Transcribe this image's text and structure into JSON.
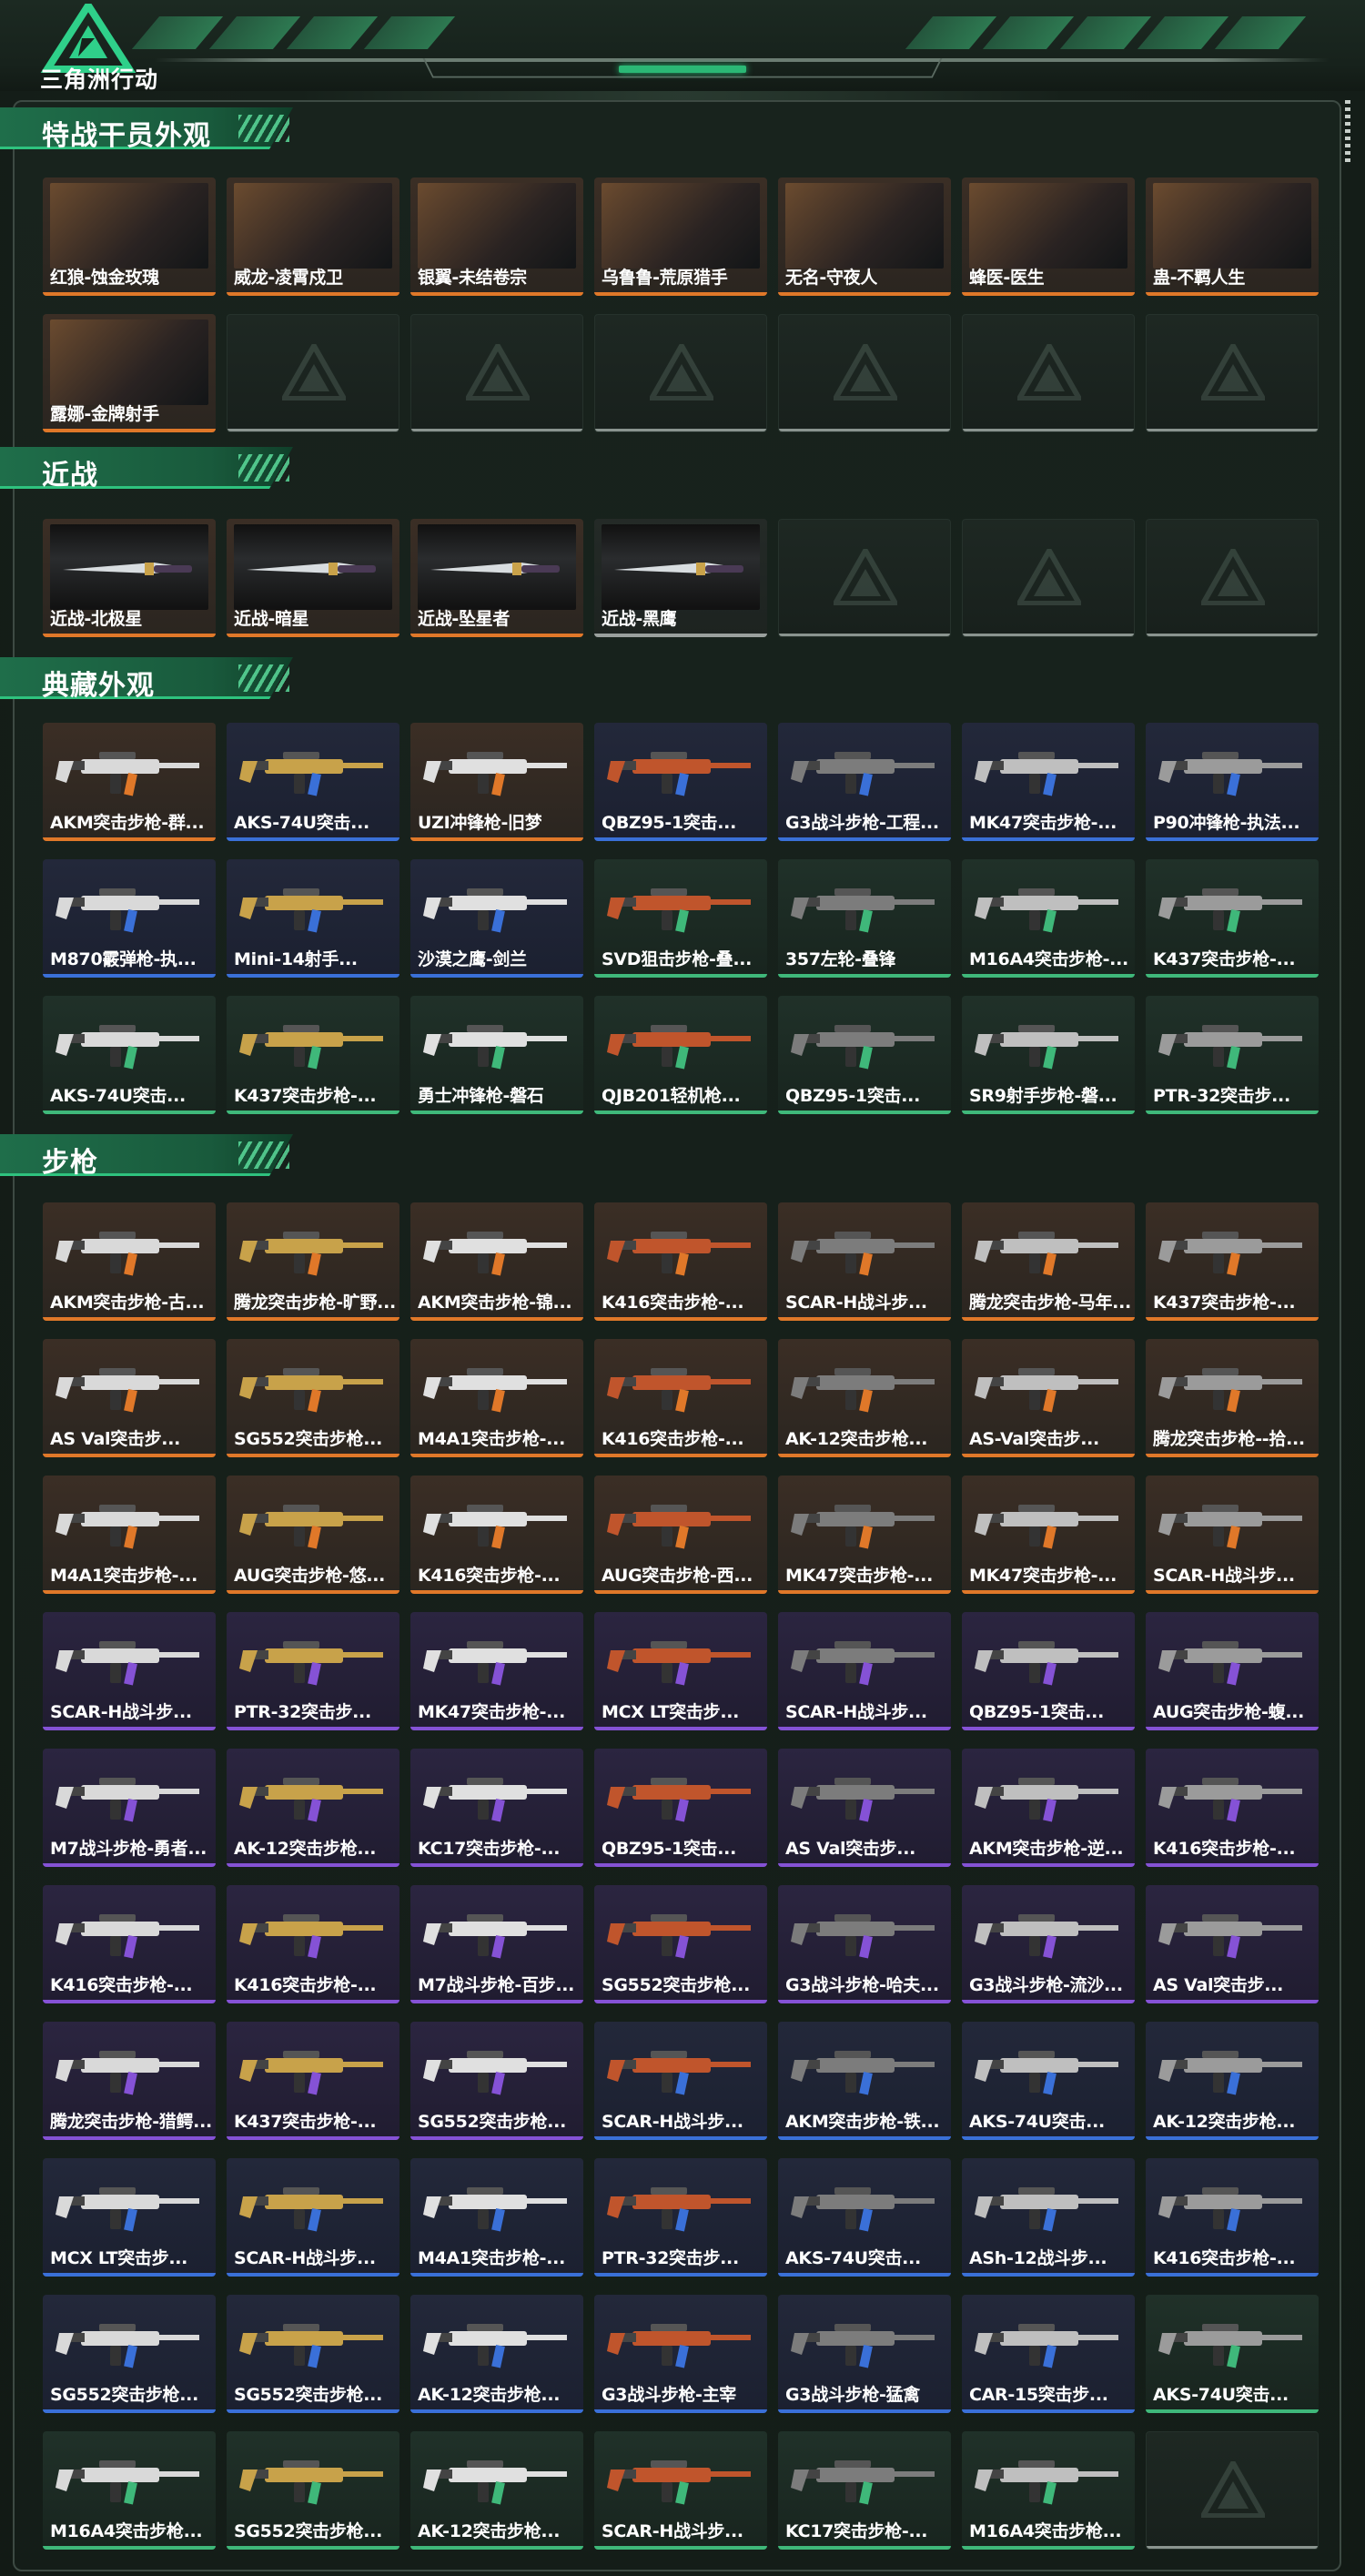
{
  "brand": {
    "logo_text": "三角洲行动"
  },
  "sections": [
    {
      "title": "特战干员外观",
      "items": [
        {
          "label": "红狼-蚀金玫瑰",
          "rarity": "orange",
          "kind": "photo"
        },
        {
          "label": "威龙-凌霄戍卫",
          "rarity": "orange",
          "kind": "photo"
        },
        {
          "label": "银翼-未结卷宗",
          "rarity": "orange",
          "kind": "photo"
        },
        {
          "label": "乌鲁鲁-荒原猎手",
          "rarity": "orange",
          "kind": "photo"
        },
        {
          "label": "无名-守夜人",
          "rarity": "orange",
          "kind": "photo"
        },
        {
          "label": "蜂医-医生",
          "rarity": "orange",
          "kind": "photo"
        },
        {
          "label": "蛊-不羁人生",
          "rarity": "orange",
          "kind": "photo"
        },
        {
          "label": "露娜-金牌射手",
          "rarity": "orange",
          "kind": "photo"
        },
        {
          "label": "",
          "rarity": "empty"
        },
        {
          "label": "",
          "rarity": "empty"
        },
        {
          "label": "",
          "rarity": "empty"
        },
        {
          "label": "",
          "rarity": "empty"
        },
        {
          "label": "",
          "rarity": "empty"
        },
        {
          "label": "",
          "rarity": "empty"
        }
      ]
    },
    {
      "title": "近战",
      "items": [
        {
          "label": "近战-北极星",
          "rarity": "orange",
          "kind": "knife"
        },
        {
          "label": "近战-暗星",
          "rarity": "orange",
          "kind": "knife"
        },
        {
          "label": "近战-坠星者",
          "rarity": "orange",
          "kind": "knife"
        },
        {
          "label": "近战-黑鹰",
          "rarity": "grey",
          "kind": "knife"
        },
        {
          "label": "",
          "rarity": "empty"
        },
        {
          "label": "",
          "rarity": "empty"
        },
        {
          "label": "",
          "rarity": "empty"
        }
      ]
    },
    {
      "title": "典藏外观",
      "items": [
        {
          "label": "AKM突击步枪-群...",
          "rarity": "orange"
        },
        {
          "label": "AKS-74U突击...",
          "rarity": "blue"
        },
        {
          "label": "UZI冲锋枪-旧梦",
          "rarity": "orange"
        },
        {
          "label": "QBZ95-1突击...",
          "rarity": "blue"
        },
        {
          "label": "G3战斗步枪-工程...",
          "rarity": "blue"
        },
        {
          "label": "MK47突击步枪-...",
          "rarity": "blue"
        },
        {
          "label": "P90冲锋枪-执法...",
          "rarity": "blue"
        },
        {
          "label": "M870霰弹枪-执...",
          "rarity": "blue"
        },
        {
          "label": "Mini-14射手...",
          "rarity": "blue"
        },
        {
          "label": "沙漠之鹰-剑兰",
          "rarity": "blue"
        },
        {
          "label": "SVD狙击步枪-叠...",
          "rarity": "green"
        },
        {
          "label": "357左轮-叠锋",
          "rarity": "green"
        },
        {
          "label": "M16A4突击步枪-...",
          "rarity": "green"
        },
        {
          "label": "K437突击步枪-...",
          "rarity": "green"
        },
        {
          "label": "AKS-74U突击...",
          "rarity": "green"
        },
        {
          "label": "K437突击步枪-...",
          "rarity": "green"
        },
        {
          "label": "勇士冲锋枪-磐石",
          "rarity": "green"
        },
        {
          "label": "QJB201轻机枪...",
          "rarity": "green"
        },
        {
          "label": "QBZ95-1突击...",
          "rarity": "green"
        },
        {
          "label": "SR9射手步枪-磐...",
          "rarity": "green"
        },
        {
          "label": "PTR-32突击步...",
          "rarity": "green"
        }
      ]
    },
    {
      "title": "步枪",
      "items": [
        {
          "label": "AKM突击步枪-古...",
          "rarity": "orange"
        },
        {
          "label": "腾龙突击步枪-旷野...",
          "rarity": "orange"
        },
        {
          "label": "AKM突击步枪-锦...",
          "rarity": "orange"
        },
        {
          "label": "K416突击步枪-...",
          "rarity": "orange"
        },
        {
          "label": "SCAR-H战斗步...",
          "rarity": "orange"
        },
        {
          "label": "腾龙突击步枪-马年...",
          "rarity": "orange"
        },
        {
          "label": "K437突击步枪-...",
          "rarity": "orange"
        },
        {
          "label": "AS Val突击步...",
          "rarity": "orange"
        },
        {
          "label": "SG552突击步枪...",
          "rarity": "orange"
        },
        {
          "label": "M4A1突击步枪-...",
          "rarity": "orange"
        },
        {
          "label": "K416突击步枪-...",
          "rarity": "orange"
        },
        {
          "label": "AK-12突击步枪...",
          "rarity": "orange"
        },
        {
          "label": "AS-Val突击步...",
          "rarity": "orange"
        },
        {
          "label": "腾龙突击步枪--拾...",
          "rarity": "orange"
        },
        {
          "label": "M4A1突击步枪-...",
          "rarity": "orange"
        },
        {
          "label": "AUG突击步枪-悠...",
          "rarity": "orange"
        },
        {
          "label": "K416突击步枪-...",
          "rarity": "orange"
        },
        {
          "label": "AUG突击步枪-西...",
          "rarity": "orange"
        },
        {
          "label": "MK47突击步枪-...",
          "rarity": "orange"
        },
        {
          "label": "MK47突击步枪-...",
          "rarity": "orange"
        },
        {
          "label": "SCAR-H战斗步...",
          "rarity": "orange"
        },
        {
          "label": "SCAR-H战斗步...",
          "rarity": "purple"
        },
        {
          "label": "PTR-32突击步...",
          "rarity": "purple"
        },
        {
          "label": "MK47突击步枪-...",
          "rarity": "purple"
        },
        {
          "label": "MCX LT突击步...",
          "rarity": "purple"
        },
        {
          "label": "SCAR-H战斗步...",
          "rarity": "purple"
        },
        {
          "label": "QBZ95-1突击...",
          "rarity": "purple"
        },
        {
          "label": "AUG突击步枪-蝮...",
          "rarity": "purple"
        },
        {
          "label": "M7战斗步枪-勇者...",
          "rarity": "purple"
        },
        {
          "label": "AK-12突击步枪...",
          "rarity": "purple"
        },
        {
          "label": "KC17突击步枪-...",
          "rarity": "purple"
        },
        {
          "label": "QBZ95-1突击...",
          "rarity": "purple"
        },
        {
          "label": "AS Val突击步...",
          "rarity": "purple"
        },
        {
          "label": "AKM突击步枪-逆...",
          "rarity": "purple"
        },
        {
          "label": "K416突击步枪-...",
          "rarity": "purple"
        },
        {
          "label": "K416突击步枪-...",
          "rarity": "purple"
        },
        {
          "label": "K416突击步枪-...",
          "rarity": "purple"
        },
        {
          "label": "M7战斗步枪-百步...",
          "rarity": "purple"
        },
        {
          "label": "SG552突击步枪...",
          "rarity": "purple"
        },
        {
          "label": "G3战斗步枪-哈夫...",
          "rarity": "purple"
        },
        {
          "label": "G3战斗步枪-流沙...",
          "rarity": "purple"
        },
        {
          "label": "AS Val突击步...",
          "rarity": "purple"
        },
        {
          "label": "腾龙突击步枪-猎鳄...",
          "rarity": "purple"
        },
        {
          "label": "K437突击步枪-...",
          "rarity": "purple"
        },
        {
          "label": "SG552突击步枪...",
          "rarity": "purple"
        },
        {
          "label": "SCAR-H战斗步...",
          "rarity": "blue"
        },
        {
          "label": "AKM突击步枪-铁...",
          "rarity": "blue"
        },
        {
          "label": "AKS-74U突击...",
          "rarity": "blue"
        },
        {
          "label": "AK-12突击步枪...",
          "rarity": "blue"
        },
        {
          "label": "MCX LT突击步...",
          "rarity": "blue"
        },
        {
          "label": "SCAR-H战斗步...",
          "rarity": "blue"
        },
        {
          "label": "M4A1突击步枪-...",
          "rarity": "blue"
        },
        {
          "label": "PTR-32突击步...",
          "rarity": "blue"
        },
        {
          "label": "AKS-74U突击...",
          "rarity": "blue"
        },
        {
          "label": "ASh-12战斗步...",
          "rarity": "blue"
        },
        {
          "label": "K416突击步枪-...",
          "rarity": "blue"
        },
        {
          "label": "SG552突击步枪...",
          "rarity": "blue"
        },
        {
          "label": "SG552突击步枪...",
          "rarity": "blue"
        },
        {
          "label": "AK-12突击步枪...",
          "rarity": "blue"
        },
        {
          "label": "G3战斗步枪-主宰",
          "rarity": "blue"
        },
        {
          "label": "G3战斗步枪-猛禽",
          "rarity": "blue"
        },
        {
          "label": "CAR-15突击步...",
          "rarity": "blue"
        },
        {
          "label": "AKS-74U突击...",
          "rarity": "green"
        },
        {
          "label": "M16A4突击步枪...",
          "rarity": "green"
        },
        {
          "label": "SG552突击步枪...",
          "rarity": "green"
        },
        {
          "label": "AK-12突击步枪...",
          "rarity": "green"
        },
        {
          "label": "SCAR-H战斗步...",
          "rarity": "green"
        },
        {
          "label": "KC17突击步枪-...",
          "rarity": "green"
        },
        {
          "label": "M16A4突击步枪...",
          "rarity": "green"
        },
        {
          "label": "",
          "rarity": "empty"
        }
      ]
    }
  ],
  "colors": {
    "orange": "#e07829",
    "blue": "#3a70d8",
    "purple": "#8552d6",
    "green": "#3fb87a",
    "grey": "#9aa09d",
    "accent": "#2ec27e"
  }
}
